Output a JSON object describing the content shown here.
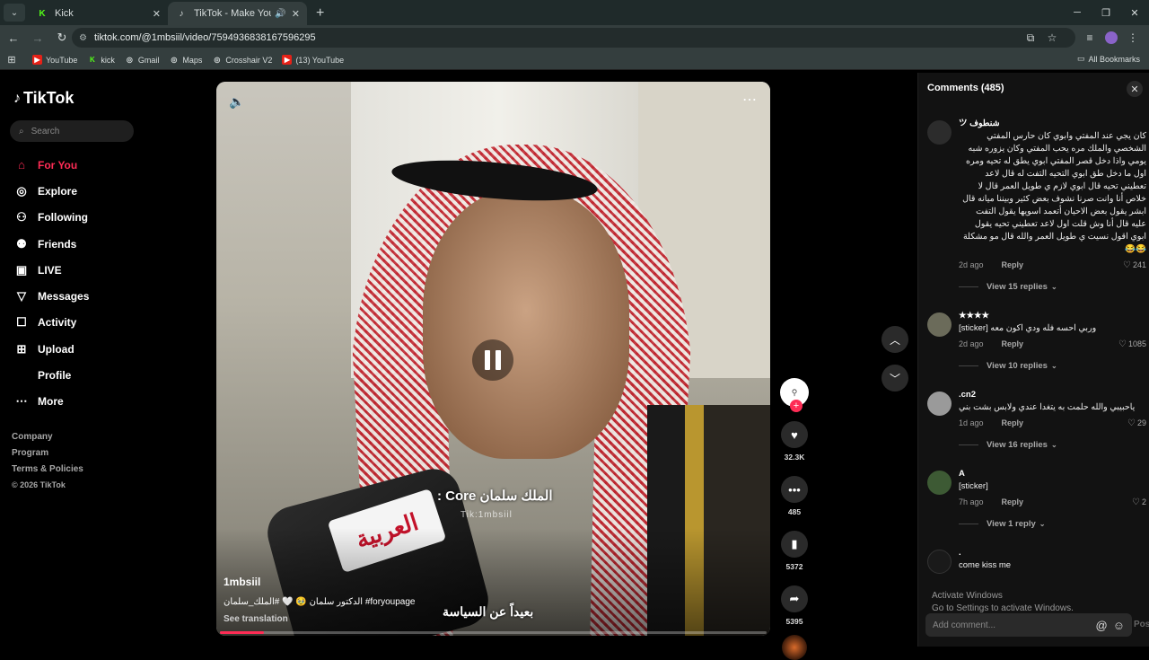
{
  "browser": {
    "tabs": [
      {
        "label": "Kick",
        "active": false
      },
      {
        "label": "TikTok - Make Your Day",
        "active": true
      }
    ],
    "url": "tiktok.com/@1mbsiil/video/7594936838167596295",
    "bookmarks": [
      "YouTube",
      "kick",
      "Gmail",
      "Maps",
      "Crosshair V2",
      "(13) YouTube"
    ],
    "all_bookmarks": "All Bookmarks"
  },
  "sidebar": {
    "logo": "TikTok",
    "search_placeholder": "Search",
    "items": [
      {
        "label": "For You",
        "icon": "home-icon",
        "active": true
      },
      {
        "label": "Explore",
        "icon": "compass-icon",
        "active": false
      },
      {
        "label": "Following",
        "icon": "person-icon",
        "active": false
      },
      {
        "label": "Friends",
        "icon": "friends-icon",
        "active": false
      },
      {
        "label": "LIVE",
        "icon": "live-icon",
        "active": false
      },
      {
        "label": "Messages",
        "icon": "send-icon",
        "active": false
      },
      {
        "label": "Activity",
        "icon": "activity-icon",
        "active": false
      },
      {
        "label": "Upload",
        "icon": "upload-icon",
        "active": false
      },
      {
        "label": "Profile",
        "icon": "profile-icon",
        "active": false
      },
      {
        "label": "More",
        "icon": "more-icon",
        "active": false
      }
    ],
    "footer": [
      "Company",
      "Program",
      "Terms & Policies",
      "© 2026 TikTok"
    ]
  },
  "video": {
    "caption_overlay": "الملك سلمان Core :",
    "watermark": "Tik:1mbsiil",
    "subtitle": "بعيداً عن السياسة",
    "mic_logo": "العربية",
    "author": "1mbsiil",
    "description": "الدكتور سلمان 🥹 🤍 #الملك_سلمان #foryoupage",
    "see_translation": "See translation",
    "progress": 0.08
  },
  "actions": {
    "likes": "32.3K",
    "comments": "485",
    "saves": "5372",
    "shares": "5395"
  },
  "comments_panel": {
    "title": "Comments (485)",
    "list": [
      {
        "user": "شنطوف ツ",
        "text": "كان يجي عند المفتي وابوي كان حارس المفتي الشخصي والملك مره يحب المفتي وكان يزوره شبه يومي واذا دخل قصر المفتي ابوي يطق له تحيه ومره اول ما دخل طق ابوي التحيه التفت له قال لاعد تعطيني تحيه قال ابوي لازم ي طويل العمر قال لا خلاص أنا وانت صرنا نشوف بعض كثير وبيننا ميانه قال ابشر يقول بعض الاحيان أتعمد اسويها يقول التفت عليه قال أنا وش قلت اول لاعد تعطيني تحيه يقول ابوي اقول نسيت ي طويل العمر والله قال مو مشكلة 😂😂",
        "rtl": true,
        "time": "2d ago",
        "reply": "Reply",
        "likes": "241",
        "replies": "View 15 replies"
      },
      {
        "user": "★★★★",
        "text": "وربي احسه فله ودي اكون معه [sticker]",
        "rtl": true,
        "time": "2d ago",
        "reply": "Reply",
        "likes": "1085",
        "replies": "View 10 replies"
      },
      {
        "user": ".cn2",
        "text": "ياحبيبي والله حلمت به يتغدا عندي ولابس بشت بني",
        "rtl": true,
        "time": "1d ago",
        "reply": "Reply",
        "likes": "29",
        "replies": "View 16 replies"
      },
      {
        "user": "A",
        "text": "[sticker]",
        "rtl": false,
        "time": "7h ago",
        "reply": "Reply",
        "likes": "2",
        "replies": "View 1 reply"
      },
      {
        "user": ".",
        "text": "come kiss me",
        "rtl": false,
        "time": "",
        "reply": "",
        "likes": "",
        "replies": ""
      }
    ],
    "input_placeholder": "Add comment...",
    "post_label": "Post",
    "activate_line1": "Activate Windows",
    "activate_line2": "Go to Settings to activate Windows."
  }
}
